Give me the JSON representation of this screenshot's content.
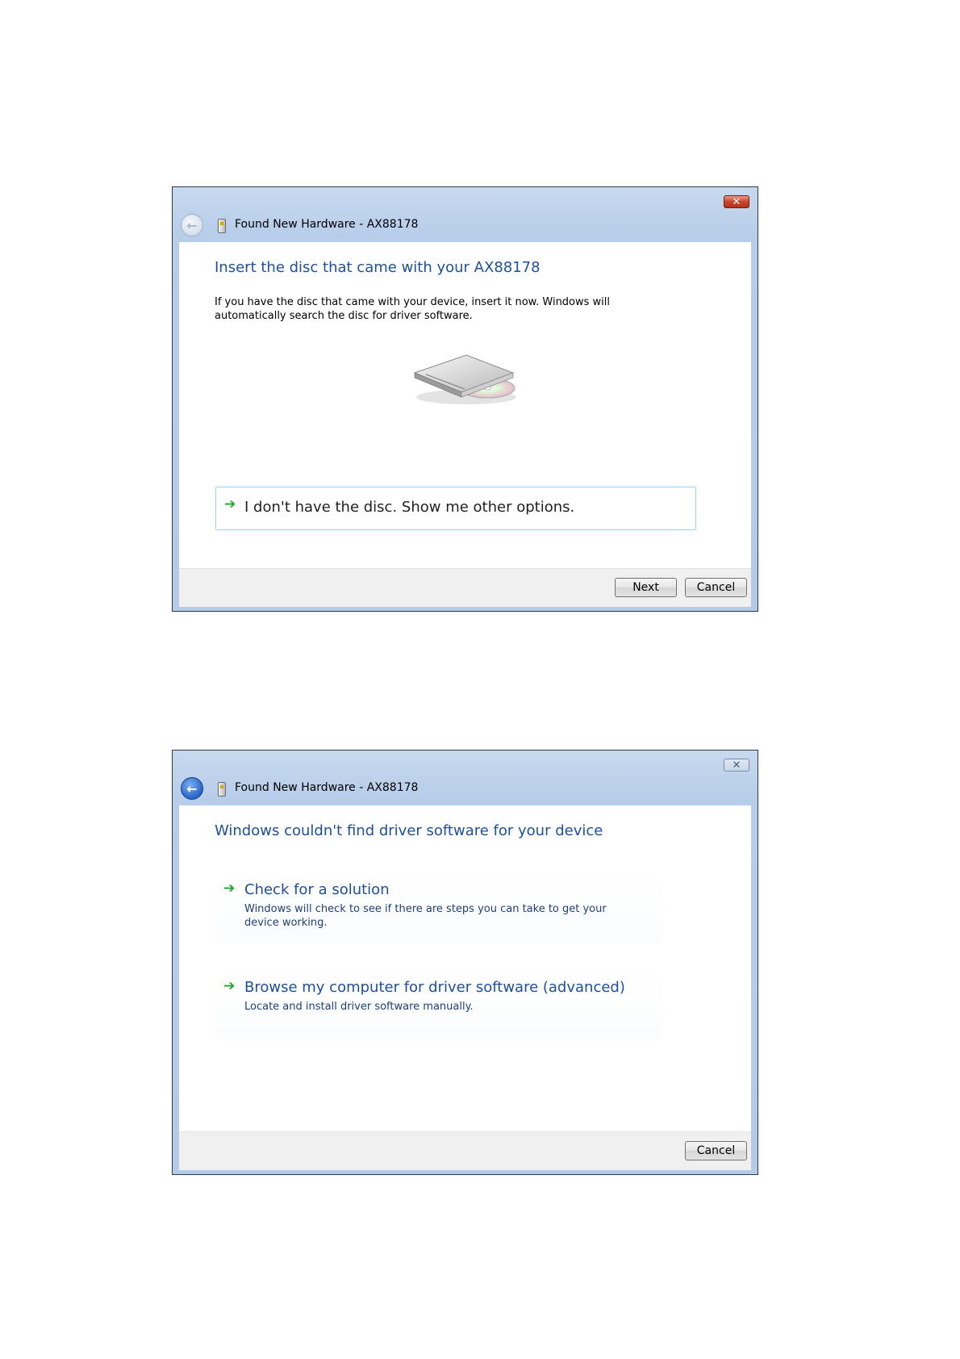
{
  "dialog_1": {
    "title": "Found New Hardware - AX88178",
    "close_icon": "close-icon",
    "heading": "Insert the disc that came with your AX88178",
    "body": "If you have the disc that came with your device, insert it now.  Windows will automatically search the disc for driver software.",
    "illustration": "disc-drive-illustration",
    "option_label": "I don't have the disc.  Show me other options.",
    "buttons": {
      "next": "Next",
      "cancel": "Cancel"
    }
  },
  "dialog_2": {
    "title": "Found New Hardware - AX88178",
    "close_icon": "close-icon",
    "heading": "Windows couldn't find driver software for your device",
    "options": [
      {
        "title": "Check for a solution",
        "description": "Windows will check to see if there are steps you can take to get your device working."
      },
      {
        "title": "Browse my computer for driver software (advanced)",
        "description": "Locate and install driver software manually."
      }
    ],
    "buttons": {
      "cancel": "Cancel"
    }
  },
  "colors": {
    "heading_blue": "#1d4f9a",
    "arrow_green": "#1fa52c",
    "frame_blue": "#b9cfea",
    "footer_gray": "#f0f0f0"
  }
}
